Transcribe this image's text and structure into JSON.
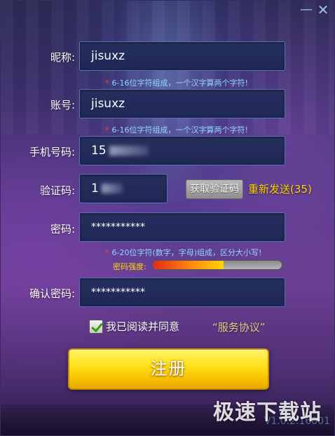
{
  "window": {
    "minimize_glyph": "—",
    "close_glyph": "✕"
  },
  "form": {
    "nickname": {
      "label": "昵称:",
      "value": "jisuxz",
      "hint": "6-16位字符组成，一个汉字算两个字符!"
    },
    "account": {
      "label": "账号:",
      "value": "jisuxz",
      "hint": "6-16位字符组成，一个汉字算两个字符!"
    },
    "phone": {
      "label": "手机号码:",
      "value_visible": "15"
    },
    "verify": {
      "label": "验证码:",
      "value_visible": "1",
      "get_code_button": "获取验证码",
      "resend_text": "重新发送(35)"
    },
    "password": {
      "label": "密码:",
      "value": "***********",
      "hint": "6-20位字符(数字，字母)组成，区分大小写!",
      "strength_label": "密码强度:",
      "strength_level": 0.55
    },
    "confirm": {
      "label": "确认密码:",
      "value": "***********"
    },
    "agree": {
      "checked": true,
      "text": "我已阅读并同意",
      "link": "“服务协议”"
    },
    "register_button": "注册"
  },
  "footer": {
    "version": "V1.0.2.16001",
    "watermark": "极速下载站"
  },
  "colors": {
    "hint": "#8fd7ff",
    "accent_yellow": "#ffd400",
    "button_yellow": "#ffe21a",
    "input_border": "#5b6fb4"
  },
  "icons": {
    "minimize": "minimize-icon",
    "close": "close-icon",
    "checkbox": "check-icon",
    "hint_marker": "asterisk-icon"
  }
}
